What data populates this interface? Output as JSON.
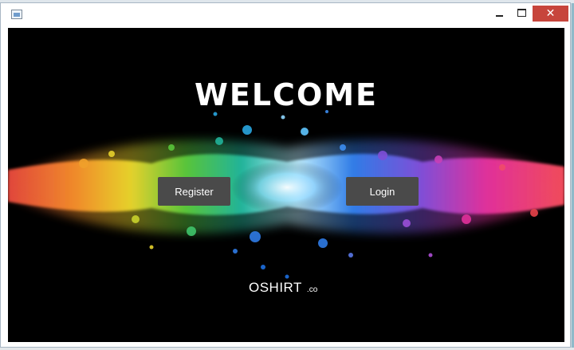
{
  "window": {
    "controls": {
      "minimize": "–",
      "maximize": "□",
      "close": "✕"
    }
  },
  "splash": {
    "title": "WELCOME",
    "register_label": "Register",
    "login_label": "Login",
    "brand_name": "OSHIRT",
    "brand_suffix": ".co"
  },
  "colors": {
    "background": "#000000",
    "button": "#4a4a4a",
    "close_button": "#c7453c",
    "text": "#ffffff"
  },
  "icons": [
    "app-icon",
    "minimize-icon",
    "maximize-icon",
    "close-icon"
  ]
}
